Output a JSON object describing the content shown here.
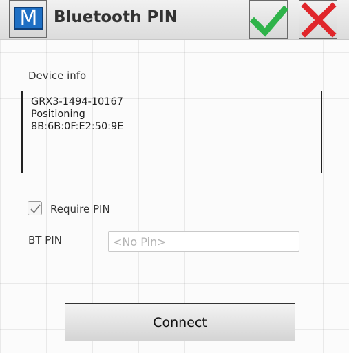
{
  "header": {
    "logo_letter": "M",
    "title": "Bluetooth PIN",
    "ok_icon": "checkmark-icon",
    "cancel_icon": "close-icon"
  },
  "device_info": {
    "label": "Device info",
    "lines": [
      "GRX3-1494-10167",
      "Positioning",
      "8B:6B:0F:E2:50:9E"
    ]
  },
  "require_pin": {
    "label": "Require PIN",
    "checked": true
  },
  "bt_pin": {
    "label": "BT PIN",
    "value": "",
    "placeholder": "<No Pin>"
  },
  "connect_label": "Connect",
  "colors": {
    "accent_green": "#2fb34a",
    "accent_red": "#e0262b",
    "logo_blue": "#1e6fc4"
  }
}
